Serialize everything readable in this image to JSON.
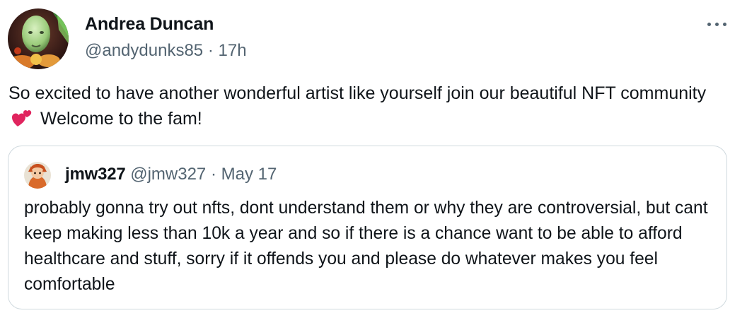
{
  "tweet": {
    "author": {
      "display_name": "Andrea Duncan",
      "handle": "@andydunks85",
      "separator": "·",
      "timestamp": "17h",
      "avatar_icon": "avatar-image"
    },
    "more_icon": "more-horizontal-icon",
    "text_before_emoji": "So excited to have another wonderful artist like yourself join our beautiful NFT community",
    "emoji": "two-hearts-emoji",
    "text_after_emoji": "Welcome to the fam!"
  },
  "quoted_tweet": {
    "author": {
      "display_name": "jmw327",
      "handle": "@jmw327",
      "separator": "·",
      "date": "May 17",
      "avatar_icon": "avatar-image"
    },
    "text": "probably gonna try out nfts, dont understand them or why they are controversial, but cant keep making less than 10k a year and so if there is a chance want to be able to afford healthcare and stuff, sorry if it offends you and please do whatever makes you feel comfortable"
  },
  "colors": {
    "primary_text": "#0f1419",
    "secondary_text": "#536471",
    "border": "#cfd9de",
    "heart": "#e0245e"
  }
}
